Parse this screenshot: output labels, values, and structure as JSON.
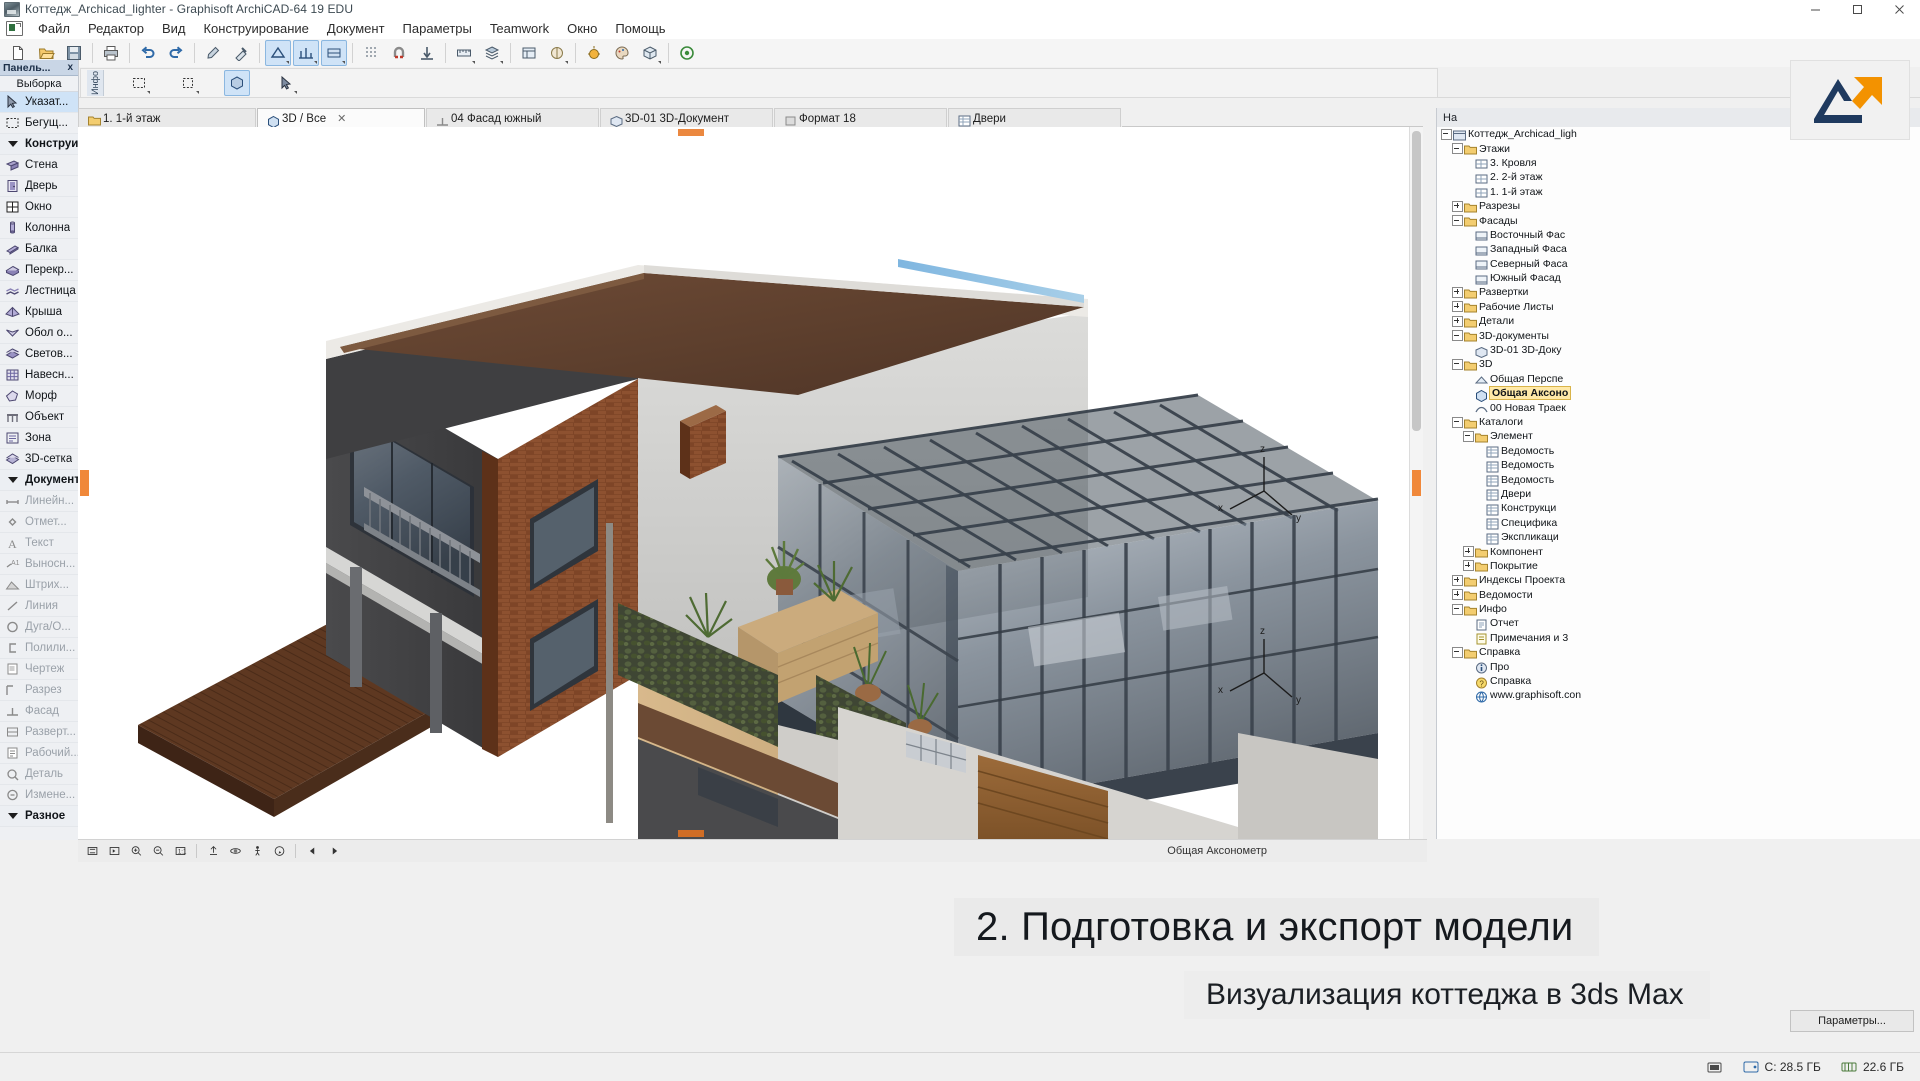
{
  "window": {
    "title": "Коттедж_Archicad_lighter - Graphisoft ArchiCAD-64 19 EDU",
    "minimize_label": "Свернуть",
    "maximize_label": "Развернуть",
    "close_label": "Закрыть"
  },
  "menu": {
    "items": [
      "Файл",
      "Редактор",
      "Вид",
      "Конструирование",
      "Документ",
      "Параметры",
      "Teamwork",
      "Окно",
      "Помощь"
    ]
  },
  "toolbar": {
    "buttons": [
      {
        "name": "new-document",
        "glyph": "new"
      },
      {
        "name": "open-document",
        "glyph": "open"
      },
      {
        "name": "save-document",
        "glyph": "save"
      },
      {
        "name": "print",
        "glyph": "print"
      },
      {
        "name": "undo",
        "glyph": "undo"
      },
      {
        "name": "redo",
        "glyph": "redo"
      },
      {
        "name": "eyedropper",
        "glyph": "pipette"
      },
      {
        "name": "syringe",
        "glyph": "syringe"
      },
      {
        "name": "measure",
        "glyph": "ruler"
      },
      {
        "name": "dimension-settings",
        "glyph": "dim"
      },
      {
        "name": "grid-snap",
        "glyph": "grid"
      },
      {
        "name": "magnet-snap",
        "glyph": "magnet"
      },
      {
        "name": "gravity",
        "glyph": "gravity"
      },
      {
        "name": "layer-settings",
        "glyph": "layers"
      },
      {
        "name": "pen-settings",
        "glyph": "pen"
      },
      {
        "name": "model-view",
        "glyph": "cube"
      },
      {
        "name": "render-settings",
        "glyph": "render"
      },
      {
        "name": "palette-toggle",
        "glyph": "palette"
      },
      {
        "name": "3d-window",
        "glyph": "3d"
      },
      {
        "name": "teamwork-status",
        "glyph": "circle"
      }
    ]
  },
  "infobox": {
    "tab_label": "Инфо"
  },
  "tabs": [
    {
      "id": "floor1",
      "label": "1. 1-й этаж",
      "icon": "floorplan-icon",
      "active": false,
      "closable": false
    },
    {
      "id": "3dall",
      "label": "3D / Все",
      "icon": "cube-icon",
      "active": true,
      "closable": true
    },
    {
      "id": "facade04",
      "label": "04 Фасад южный",
      "icon": "elevation-icon",
      "active": false,
      "closable": false
    },
    {
      "id": "doc3d01",
      "label": "3D-01 3D-Документ",
      "icon": "doc3d-icon",
      "active": false,
      "closable": false
    },
    {
      "id": "format18",
      "label": "Формат 18",
      "icon": "layout-icon",
      "active": false,
      "closable": false
    },
    {
      "id": "doors",
      "label": "Двери",
      "icon": "schedule-icon",
      "active": false,
      "closable": false
    }
  ],
  "palette": {
    "title": "Панель...",
    "close_label": "x",
    "section_select": "Выборка",
    "groups": [
      {
        "name": "selection",
        "items": [
          {
            "label": "Указат...",
            "icon": "arrow-pointer-icon",
            "selected": true,
            "dim": false
          },
          {
            "label": "Бегущ...",
            "icon": "marquee-icon",
            "selected": false,
            "dim": false
          }
        ]
      },
      {
        "name": "design",
        "header": "Конструирс",
        "items": [
          {
            "label": "Стена",
            "icon": "wall-icon",
            "selected": false,
            "dim": false
          },
          {
            "label": "Дверь",
            "icon": "door-icon",
            "selected": false,
            "dim": false
          },
          {
            "label": "Окно",
            "icon": "window-icon",
            "selected": false,
            "dim": false
          },
          {
            "label": "Колонна",
            "icon": "column-icon",
            "selected": false,
            "dim": false
          },
          {
            "label": "Балка",
            "icon": "beam-icon",
            "selected": false,
            "dim": false
          },
          {
            "label": "Перекр...",
            "icon": "slab-icon",
            "selected": false,
            "dim": false
          },
          {
            "label": "Лестница",
            "icon": "stair-icon",
            "selected": false,
            "dim": false
          },
          {
            "label": "Крыша",
            "icon": "roof-icon",
            "selected": false,
            "dim": false
          },
          {
            "label": "Обол о...",
            "icon": "shell-icon",
            "selected": false,
            "dim": false
          },
          {
            "label": "Светов...",
            "icon": "skylight-icon",
            "selected": false,
            "dim": false
          },
          {
            "label": "Навесн...",
            "icon": "curtainwall-icon",
            "selected": false,
            "dim": false
          },
          {
            "label": "Морф",
            "icon": "morph-icon",
            "selected": false,
            "dim": false
          },
          {
            "label": "Объект",
            "icon": "object-icon",
            "selected": false,
            "dim": false
          },
          {
            "label": "Зона",
            "icon": "zone-icon",
            "selected": false,
            "dim": false
          },
          {
            "label": "3D-сетка",
            "icon": "mesh-icon",
            "selected": false,
            "dim": false
          }
        ]
      },
      {
        "name": "documentation",
        "header": "Документиј",
        "items": [
          {
            "label": "Линейн...",
            "icon": "dimension-icon",
            "selected": false,
            "dim": true
          },
          {
            "label": "Отмет...",
            "icon": "levelmark-icon",
            "selected": false,
            "dim": true
          },
          {
            "label": "Текст",
            "icon": "text-icon",
            "selected": false,
            "dim": true
          },
          {
            "label": "Выносн...",
            "icon": "label-icon",
            "selected": false,
            "dim": true
          },
          {
            "label": "Штрих...",
            "icon": "fill-icon",
            "selected": false,
            "dim": true
          },
          {
            "label": "Линия",
            "icon": "line-icon",
            "selected": false,
            "dim": true
          },
          {
            "label": "Дуга/О...",
            "icon": "arc-icon",
            "selected": false,
            "dim": true
          },
          {
            "label": "Полили...",
            "icon": "polyline-icon",
            "selected": false,
            "dim": true
          },
          {
            "label": "Чертеж",
            "icon": "drawing-icon",
            "selected": false,
            "dim": true
          },
          {
            "label": "Разрез",
            "icon": "section-icon",
            "selected": false,
            "dim": true
          },
          {
            "label": "Фасад",
            "icon": "elevation-icon",
            "selected": false,
            "dim": true
          },
          {
            "label": "Разверт...",
            "icon": "interior-elev-icon",
            "selected": false,
            "dim": true
          },
          {
            "label": "Рабочий...",
            "icon": "worksheet-icon",
            "selected": false,
            "dim": true
          },
          {
            "label": "Деталь",
            "icon": "detail-icon",
            "selected": false,
            "dim": true
          },
          {
            "label": "Измене...",
            "icon": "change-icon",
            "selected": false,
            "dim": true
          }
        ]
      },
      {
        "name": "misc",
        "header": "Разное",
        "items": []
      }
    ]
  },
  "navigator": {
    "header": "На",
    "params_button": "Параметры...",
    "tree": [
      {
        "label": "Коттедж_Archicad_ligh",
        "depth": 0,
        "toggle": "minus",
        "icon": "project-icon",
        "selected": false
      },
      {
        "label": "Этажи",
        "depth": 1,
        "toggle": "minus",
        "icon": "folder-icon",
        "selected": false
      },
      {
        "label": "3. Кровля",
        "depth": 2,
        "toggle": "none",
        "icon": "story-icon",
        "selected": false
      },
      {
        "label": "2. 2-й этаж",
        "depth": 2,
        "toggle": "none",
        "icon": "story-icon",
        "selected": false
      },
      {
        "label": "1. 1-й этаж",
        "depth": 2,
        "toggle": "none",
        "icon": "story-icon",
        "selected": false
      },
      {
        "label": "Разрезы",
        "depth": 1,
        "toggle": "plus",
        "icon": "folder-icon",
        "selected": false
      },
      {
        "label": "Фасады",
        "depth": 1,
        "toggle": "minus",
        "icon": "folder-icon",
        "selected": false
      },
      {
        "label": "Восточный Фас",
        "depth": 2,
        "toggle": "none",
        "icon": "elev-icon",
        "selected": false
      },
      {
        "label": "Западный Фаса",
        "depth": 2,
        "toggle": "none",
        "icon": "elev-icon",
        "selected": false
      },
      {
        "label": "Северный Фаса",
        "depth": 2,
        "toggle": "none",
        "icon": "elev-icon",
        "selected": false
      },
      {
        "label": "Южный Фасад",
        "depth": 2,
        "toggle": "none",
        "icon": "elev-icon",
        "selected": false
      },
      {
        "label": "Развертки",
        "depth": 1,
        "toggle": "plus",
        "icon": "folder-icon",
        "selected": false
      },
      {
        "label": "Рабочие Листы",
        "depth": 1,
        "toggle": "plus",
        "icon": "folder-icon",
        "selected": false
      },
      {
        "label": "Детали",
        "depth": 1,
        "toggle": "plus",
        "icon": "folder-icon",
        "selected": false
      },
      {
        "label": "3D-документы",
        "depth": 1,
        "toggle": "minus",
        "icon": "folder-icon",
        "selected": false
      },
      {
        "label": "3D-01 3D-Доку",
        "depth": 2,
        "toggle": "none",
        "icon": "doc3d-icon",
        "selected": false
      },
      {
        "label": "3D",
        "depth": 1,
        "toggle": "minus",
        "icon": "folder-icon",
        "selected": false
      },
      {
        "label": "Общая Перспе",
        "depth": 2,
        "toggle": "none",
        "icon": "persp-icon",
        "selected": false
      },
      {
        "label": "Общая Аксоно",
        "depth": 2,
        "toggle": "none",
        "icon": "axono-icon",
        "selected": true
      },
      {
        "label": "00 Новая Траек",
        "depth": 2,
        "toggle": "none",
        "icon": "path-icon",
        "selected": false
      },
      {
        "label": "Каталоги",
        "depth": 1,
        "toggle": "minus",
        "icon": "folder-icon",
        "selected": false
      },
      {
        "label": "Элемент",
        "depth": 2,
        "toggle": "minus",
        "icon": "folder-icon",
        "selected": false
      },
      {
        "label": "Ведомость",
        "depth": 3,
        "toggle": "none",
        "icon": "schedule-icon",
        "selected": false
      },
      {
        "label": "Ведомость",
        "depth": 3,
        "toggle": "none",
        "icon": "schedule-icon",
        "selected": false
      },
      {
        "label": "Ведомость",
        "depth": 3,
        "toggle": "none",
        "icon": "schedule-icon",
        "selected": false
      },
      {
        "label": "Двери",
        "depth": 3,
        "toggle": "none",
        "icon": "schedule-icon",
        "selected": false
      },
      {
        "label": "Конструкци",
        "depth": 3,
        "toggle": "none",
        "icon": "schedule-icon",
        "selected": false
      },
      {
        "label": "Специфика",
        "depth": 3,
        "toggle": "none",
        "icon": "schedule-icon",
        "selected": false
      },
      {
        "label": "Экспликаци",
        "depth": 3,
        "toggle": "none",
        "icon": "schedule-icon",
        "selected": false
      },
      {
        "label": "Компонент",
        "depth": 2,
        "toggle": "plus",
        "icon": "folder-icon",
        "selected": false
      },
      {
        "label": "Покрытие",
        "depth": 2,
        "toggle": "plus",
        "icon": "folder-icon",
        "selected": false
      },
      {
        "label": "Индексы Проекта",
        "depth": 1,
        "toggle": "plus",
        "icon": "folder-icon",
        "selected": false
      },
      {
        "label": "Ведомости",
        "depth": 1,
        "toggle": "plus",
        "icon": "folder-icon",
        "selected": false
      },
      {
        "label": "Инфо",
        "depth": 1,
        "toggle": "minus",
        "icon": "folder-icon",
        "selected": false
      },
      {
        "label": "Отчет",
        "depth": 2,
        "toggle": "none",
        "icon": "report-icon",
        "selected": false
      },
      {
        "label": "Примечания и 3",
        "depth": 2,
        "toggle": "none",
        "icon": "note-icon",
        "selected": false
      },
      {
        "label": "Справка",
        "depth": 1,
        "toggle": "minus",
        "icon": "folder-icon",
        "selected": false
      },
      {
        "label": "Про",
        "depth": 2,
        "toggle": "none",
        "icon": "info-icon",
        "selected": false
      },
      {
        "label": "Справка",
        "depth": 2,
        "toggle": "none",
        "icon": "help-icon",
        "selected": false
      },
      {
        "label": "www.graphisoft.con",
        "depth": 2,
        "toggle": "none",
        "icon": "web-icon",
        "selected": false
      }
    ]
  },
  "viewport": {
    "view_name": "Общая Аксонометр",
    "nav_buttons": [
      {
        "name": "fit-in-window-button",
        "glyph": "fit"
      },
      {
        "name": "zoom-previous-button",
        "glyph": "prev"
      },
      {
        "name": "zoom-in-button",
        "glyph": "zoomin"
      },
      {
        "name": "zoom-out-button",
        "glyph": "zoomout"
      },
      {
        "name": "zoom-actual-button",
        "glyph": "actual"
      },
      {
        "name": "pan-button",
        "glyph": "pan"
      },
      {
        "name": "orbit-button",
        "glyph": "orbit"
      },
      {
        "name": "walk-button",
        "glyph": "walk"
      },
      {
        "name": "explore-button",
        "glyph": "explore"
      },
      {
        "name": "nav-prev-button",
        "glyph": "arrowleft"
      },
      {
        "name": "nav-next-button",
        "glyph": "arrowright"
      }
    ]
  },
  "overlay": {
    "heading": "2. Подготовка и экспорт модели",
    "subheading": "Визуализация коттеджа в 3ds Max"
  },
  "statusbar": {
    "drive_c_label": "C: 28.5 ГБ",
    "memory_label": "22.6 ГБ",
    "tray_icons": [
      "network-icon",
      "volume-icon",
      "battery-icon"
    ]
  },
  "colors": {
    "accent": "#cfe3f7",
    "selection_highlight": "#ffe9a8",
    "titlebar_bg": "#ffffff",
    "panel_bg": "#eef0f3",
    "viewport_bg": "#ffffff",
    "orange_marker": "#e8731e"
  }
}
